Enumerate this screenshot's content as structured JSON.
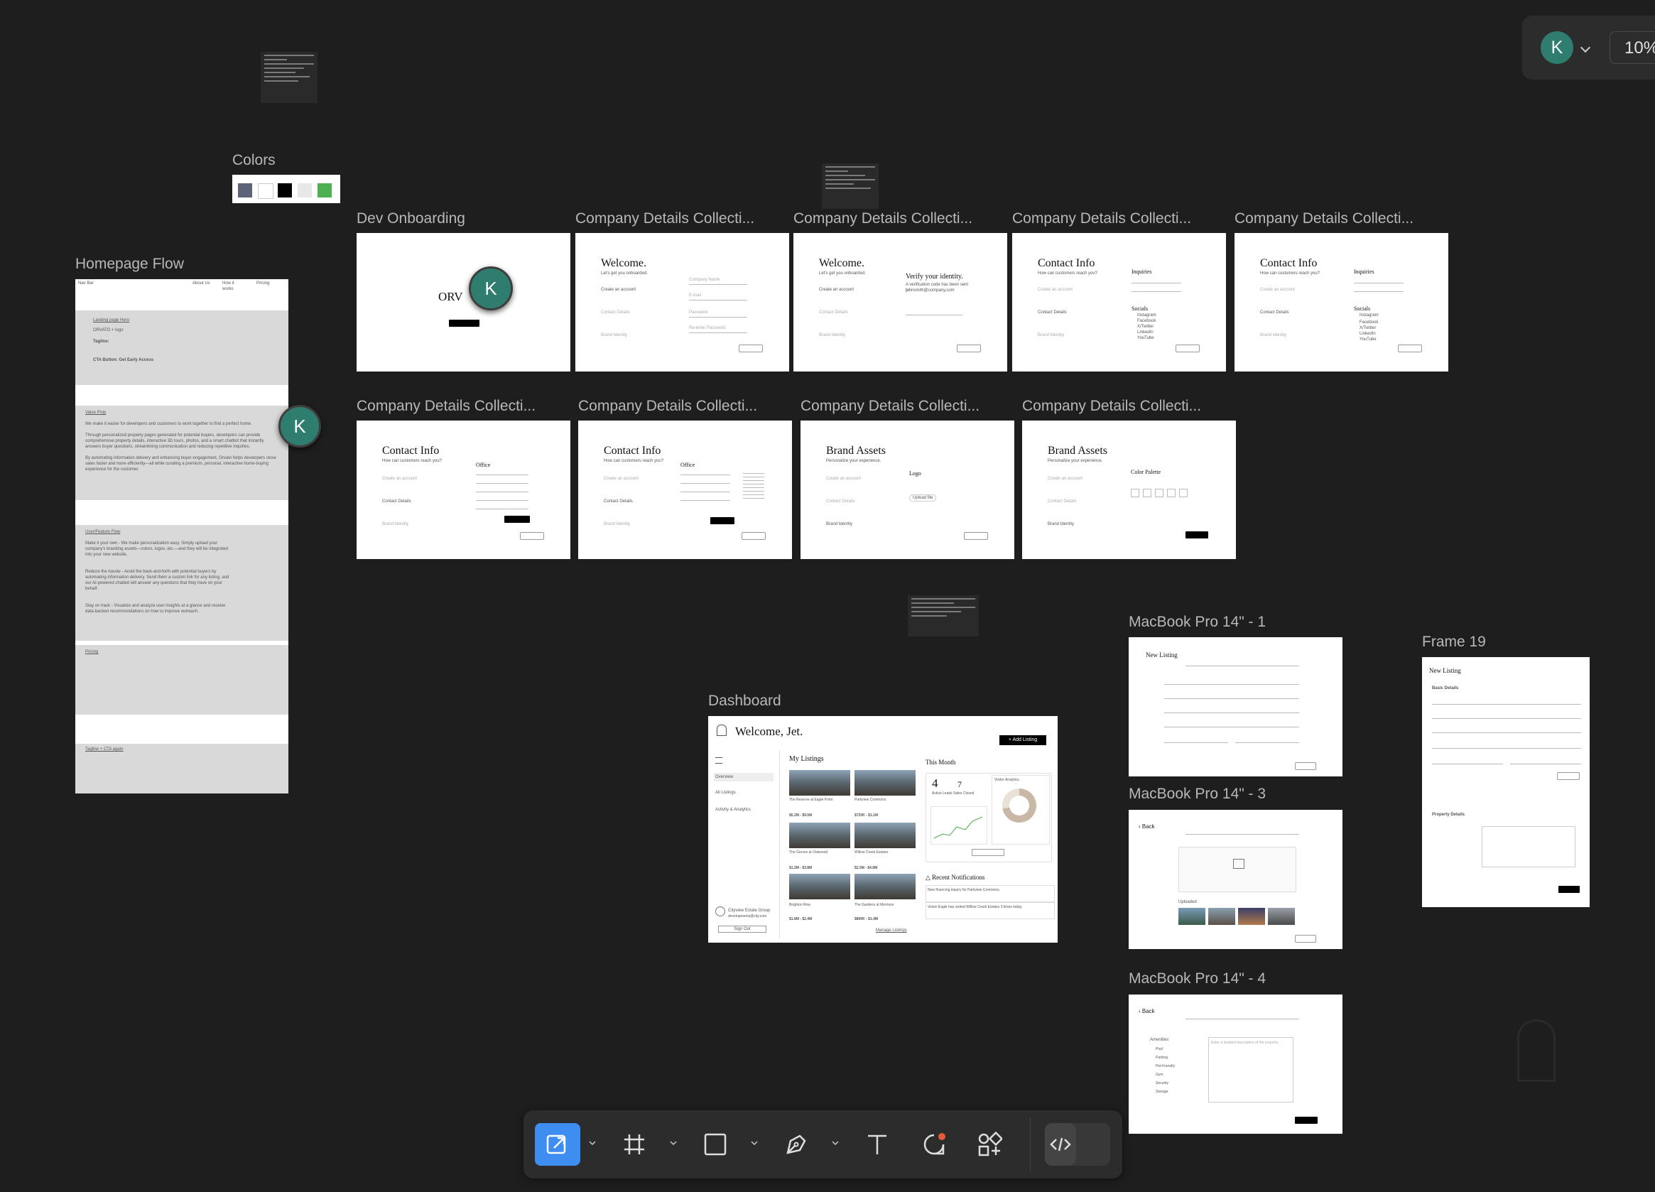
{
  "top_right": {
    "avatar_initial": "K",
    "zoom": "10%"
  },
  "collaborator": {
    "initial": "K"
  },
  "frames": {
    "colors": {
      "label": "Colors",
      "swatches": [
        "#5d6478",
        "#ffffff",
        "#000000",
        "#e8e8e8",
        "#4caf50"
      ]
    },
    "homepage_flow": {
      "label": "Homepage Flow",
      "nav": {
        "brand": "Nav Bar",
        "about": "About Us",
        "how": "How it works",
        "pricing": "Pricing"
      },
      "hero_title": "Landing page Hero",
      "hero_logo": "ORVATO + logo",
      "hero_tagline": "Tagline:",
      "hero_cta": "CTA Button: Get Early Access",
      "value_title": "Value Prop",
      "value_p1": "We make it easier for developers and customers to work together to find a perfect home.",
      "value_p2": "Through personalized property pages generated for potential buyers, developers can provide comprehensive property details, interactive 3D tours, photos, and a smart chatbot that instantly answers buyer questions, streamlining communication and reducing repetitive inquiries.",
      "value_p3": "By automating information delivery and enhancing buyer engagement, Orvato helps developers close sales faster and more efficiently—all while curating a premium, personal, interactive home-buying experience for the customer.",
      "feature_title": "User/Feature Flow",
      "feature_1": "Make it your own - We make personalization easy. Simply upload your company's branding assets—colors, logos, etc.—and they will be integrated into your new website.",
      "feature_2": "Reduce the hassle - Avoid the back-and-forth with potential buyers by automating information delivery. Send them a custom link for any listing, and our AI-powered chatbot will answer any questions that they have on your behalf.",
      "feature_3": "Stay on track - Visualize and analyze user insights at a glance and receive data-backed recommendations on how to improve outreach.",
      "pricing": "Pricing",
      "footer": "Tagline + CTA again"
    },
    "dev_onboarding": {
      "label": "Dev Onboarding",
      "logo": "ORV"
    },
    "cdc_label": "Company Details Collecti...",
    "welcome": {
      "title": "Welcome.",
      "subtitle": "Let's get you onboarded.",
      "steps": [
        "Create an account",
        "Contact Details",
        "Brand Identity"
      ],
      "fields": [
        "Company Name",
        "E-mail",
        "Password",
        "Re-enter Password"
      ],
      "next": "Next"
    },
    "verify": {
      "title": "Verify your identity.",
      "subtitle": "A verification code has been sent to",
      "email": "johnsmith@company.com"
    },
    "contact": {
      "title": "Contact Info",
      "subtitle": "How can customers reach you?",
      "inquiries": "Inquiries",
      "socials": "Socials",
      "social_list": [
        "Instagram",
        "Facebook",
        "X/Twitter",
        "LinkedIn",
        "YouTube"
      ],
      "office": "Office"
    },
    "brand": {
      "title": "Brand Assets",
      "subtitle": "Personalize your experience.",
      "logo": "Logo",
      "upload": "Upload file",
      "palette": "Color Palette",
      "finish": "Finish"
    },
    "dashboard": {
      "label": "Dashboard",
      "welcome": "Welcome, Jet.",
      "add_listing": "Add Listing",
      "nav": [
        "Overview",
        "All Listings",
        "Activity & Analytics"
      ],
      "company": "Cityview Estate Group",
      "company_email": "developments@city.com",
      "sign_out": "Sign Out",
      "my_listings": "My Listings",
      "listings": [
        {
          "name": "The Reserve at Eagle Point",
          "price": "$5.2M - $9.5M"
        },
        {
          "name": "Parkview Commons",
          "price": "$720K - $1.1M"
        },
        {
          "name": "The Groves at Oakwood",
          "price": "$1.2M - $3.8M"
        },
        {
          "name": "Willow Creek Estates",
          "price": "$2.5M - $4.8M"
        },
        {
          "name": "Brighton Row",
          "price": "$1.8M - $2.4M"
        },
        {
          "name": "The Gardens at Morrison",
          "price": "$890K - $1.4M"
        }
      ],
      "manage": "Manage Listings",
      "this_month": "This Month",
      "active_leads_value": "4",
      "active_leads": "Active Leads",
      "sales_closed_value": "7",
      "sales_closed": "Sales Closed",
      "visitor_analytics": "Visitor Analytics",
      "notifications_title": "Recent Notifications",
      "notifications": [
        "New financing inquiry for Parkview Commons.",
        "Vision Eagle has visited Willow Creek Estates 3 times today."
      ]
    },
    "mbp1": {
      "label": "MacBook Pro 14\" - 1",
      "title": "New Listing"
    },
    "mbp3": {
      "label": "MacBook Pro 14\" - 3",
      "back": "Back",
      "uploaded": "Uploaded"
    },
    "mbp4": {
      "label": "MacBook Pro 14\" - 4",
      "back": "Back",
      "amenities": "Amenities",
      "amenity_list": [
        "Pool",
        "Parking",
        "Pet-Friendly",
        "Gym",
        "Security",
        "Storage"
      ],
      "placeholder": "Enter a detailed description of the property..."
    },
    "frame19": {
      "label": "Frame 19",
      "title": "New Listing",
      "basic": "Basic Details",
      "property": "Property Details"
    }
  },
  "toolbar": {
    "tools": [
      "move-tool",
      "frame-tool",
      "shape-tool",
      "pen-tool",
      "text-tool",
      "comment-tool",
      "actions-tool",
      "dev-mode-toggle"
    ]
  }
}
